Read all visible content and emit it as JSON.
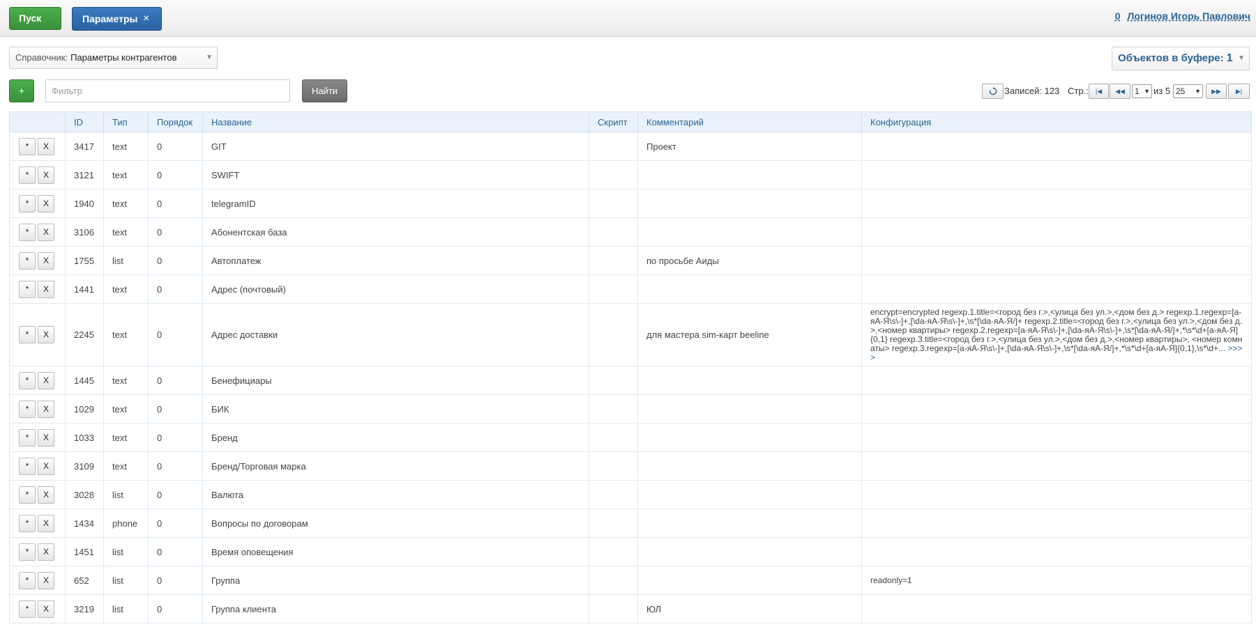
{
  "topbar": {
    "start_label": "Пуск",
    "active_tab_label": "Параметры",
    "active_tab_close": "×",
    "user_count": "0",
    "user_name": "Логинов Игорь Павлович"
  },
  "dict": {
    "label": "Справочник:",
    "value": "Параметры контрагентов"
  },
  "buffer": {
    "label": "Объектов в буфере:",
    "count": "1"
  },
  "toolbar": {
    "add_label": "+",
    "filter_placeholder": "Фильтр",
    "find_label": "Найти"
  },
  "pager": {
    "records_label": "Записей: 123",
    "page_label": "Стр.:",
    "first": "|◀",
    "prev": "◀◀",
    "page_value": "1",
    "of_label": "из 5",
    "per_page_value": "25",
    "next": "▶▶",
    "last": "▶|",
    "refresh_icon": "refresh-icon"
  },
  "table": {
    "headers": [
      "",
      "ID",
      "Тип",
      "Порядок",
      "Название",
      "Скрипт",
      "Комментарий",
      "Конфигурация"
    ],
    "edit_label": "*",
    "delete_label": "X",
    "rows": [
      {
        "id": "3417",
        "type": "text",
        "order": "0",
        "name": "GIT",
        "script": "",
        "comment": "Проект",
        "config": ""
      },
      {
        "id": "3121",
        "type": "text",
        "order": "0",
        "name": "SWIFT",
        "script": "",
        "comment": "",
        "config": ""
      },
      {
        "id": "1940",
        "type": "text",
        "order": "0",
        "name": "telegramID",
        "script": "",
        "comment": "",
        "config": ""
      },
      {
        "id": "3106",
        "type": "text",
        "order": "0",
        "name": "Абонентская база",
        "script": "",
        "comment": "",
        "config": ""
      },
      {
        "id": "1755",
        "type": "list",
        "order": "0",
        "name": "Автоплатеж",
        "script": "",
        "comment": "по просьбе Аиды",
        "config": ""
      },
      {
        "id": "1441",
        "type": "text",
        "order": "0",
        "name": "Адрес (почтовый)",
        "script": "",
        "comment": "",
        "config": ""
      },
      {
        "id": "2245",
        "type": "text",
        "order": "0",
        "name": "Адрес доставки",
        "script": "",
        "comment": "для мастера sim-карт beeline",
        "config": "encrypt=encrypted regexp.1.title=<город без г.>,<улица без ул.>,<дом без д.> regexp.1.regexp=[а-яА-Я\\s\\-]+,[\\da-яА-Я\\s\\-]+,\\s*[\\da-яА-Я/]+ regexp.2.title=<город без г.>,<улица без ул.>,<дом без д.>,<номер квартиры> regexp.2.regexp=[а-яА-Я\\s\\-]+,[\\da-яА-Я\\s\\-]+,\\s*[\\da-яА-Я/]+,*\\s*\\d+[а-яА-Я]{0,1} regexp.3.title=<город без г.>,<улица без ул.>,<дом без д.>,<номер квартиры>, <номер комнаты> regexp.3.regexp=[а-яА-Я\\s\\-]+,[\\da-яА-Я\\s\\-]+,\\s*[\\da-яА-Я/]+,*\\s*\\d+[а-яА-Я]{0,1},\\s*\\d+...",
        "config_more": ">>>>"
      },
      {
        "id": "1445",
        "type": "text",
        "order": "0",
        "name": "Бенефициары",
        "script": "",
        "comment": "",
        "config": ""
      },
      {
        "id": "1029",
        "type": "text",
        "order": "0",
        "name": "БИК",
        "script": "",
        "comment": "",
        "config": ""
      },
      {
        "id": "1033",
        "type": "text",
        "order": "0",
        "name": "Бренд",
        "script": "",
        "comment": "",
        "config": ""
      },
      {
        "id": "3109",
        "type": "text",
        "order": "0",
        "name": "Бренд/Торговая марка",
        "script": "",
        "comment": "",
        "config": ""
      },
      {
        "id": "3028",
        "type": "list",
        "order": "0",
        "name": "Валюта",
        "script": "",
        "comment": "",
        "config": ""
      },
      {
        "id": "1434",
        "type": "phone",
        "order": "0",
        "name": "Вопросы по договорам",
        "script": "",
        "comment": "",
        "config": ""
      },
      {
        "id": "1451",
        "type": "list",
        "order": "0",
        "name": "Время оповещения",
        "script": "",
        "comment": "",
        "config": ""
      },
      {
        "id": "652",
        "type": "list",
        "order": "0",
        "name": "Группа",
        "script": "",
        "comment": "",
        "config": "readonly=1"
      },
      {
        "id": "3219",
        "type": "list",
        "order": "0",
        "name": "Группа клиента",
        "script": "",
        "comment": "ЮЛ",
        "config": ""
      }
    ]
  }
}
